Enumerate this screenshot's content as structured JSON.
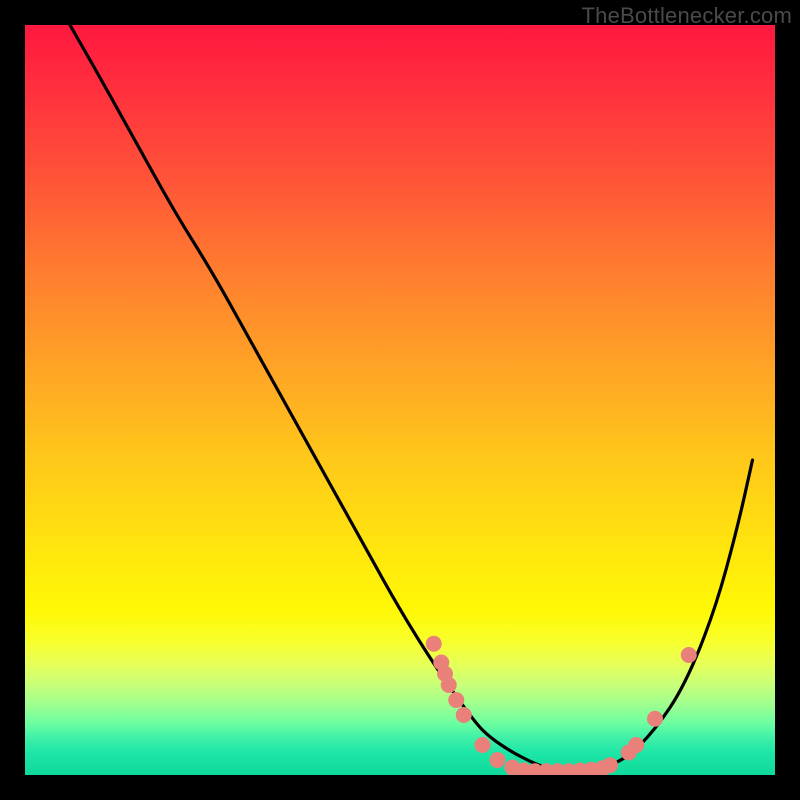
{
  "attribution": "TheBottlenecker.com",
  "chart_data": {
    "type": "line",
    "title": "",
    "xlabel": "",
    "ylabel": "",
    "xlim": [
      0,
      100
    ],
    "ylim": [
      0,
      100
    ],
    "note": "Axis values are unlabeled in the source image; x/y are reported in percent of plot width/height (0 = left/bottom, 100 = right/top). The single curve descends from upper-left to a flat minimum near the bottom, then rises toward the right.",
    "series": [
      {
        "name": "curve",
        "color": "#000000",
        "x": [
          6,
          10,
          15,
          20,
          25,
          30,
          35,
          40,
          45,
          50,
          55,
          60,
          62,
          65,
          68,
          70,
          73,
          76,
          80,
          84,
          88,
          92,
          95,
          97
        ],
        "y": [
          100,
          93,
          84,
          75,
          67,
          58,
          49,
          40,
          31,
          22,
          14,
          7,
          5,
          3,
          1.5,
          0.8,
          0.5,
          0.7,
          2,
          6,
          12,
          22,
          33,
          42
        ]
      }
    ],
    "scatter_points": {
      "name": "dots",
      "color": "#e9817a",
      "note": "Clustered markers along the curve near the minimum and on the rising branch. Coordinates are percent of plot area.",
      "points": [
        {
          "x": 54.5,
          "y": 17.5
        },
        {
          "x": 55.5,
          "y": 15.0
        },
        {
          "x": 56.0,
          "y": 13.5
        },
        {
          "x": 56.5,
          "y": 12.0
        },
        {
          "x": 57.5,
          "y": 10.0
        },
        {
          "x": 58.5,
          "y": 8.0
        },
        {
          "x": 61.0,
          "y": 4.0
        },
        {
          "x": 63.0,
          "y": 2.0
        },
        {
          "x": 65.0,
          "y": 1.0
        },
        {
          "x": 66.5,
          "y": 0.6
        },
        {
          "x": 68.0,
          "y": 0.5
        },
        {
          "x": 69.5,
          "y": 0.5
        },
        {
          "x": 71.0,
          "y": 0.5
        },
        {
          "x": 72.5,
          "y": 0.5
        },
        {
          "x": 74.0,
          "y": 0.6
        },
        {
          "x": 75.5,
          "y": 0.7
        },
        {
          "x": 77.0,
          "y": 0.9
        },
        {
          "x": 78.0,
          "y": 1.3
        },
        {
          "x": 80.5,
          "y": 3.0
        },
        {
          "x": 81.5,
          "y": 4.0
        },
        {
          "x": 84.0,
          "y": 7.5
        },
        {
          "x": 88.5,
          "y": 16.0
        }
      ]
    }
  }
}
